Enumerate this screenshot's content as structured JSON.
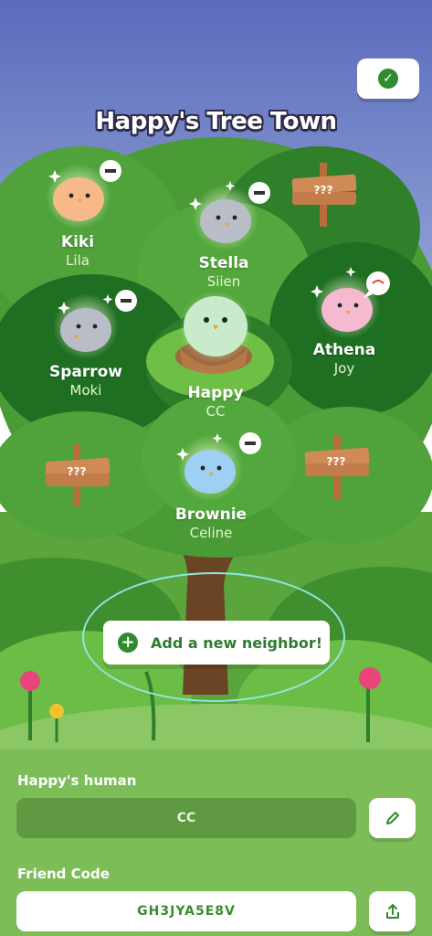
{
  "town": {
    "title": "Happy's Tree Town"
  },
  "birds": [
    {
      "name": "Kiki",
      "human": "Lila",
      "color": "#f6b98a"
    },
    {
      "name": "Stella",
      "human": "Siien",
      "color": "#b9bdc8"
    },
    {
      "name": "Sparrow",
      "human": "Moki",
      "color": "#b9bdc8"
    },
    {
      "name": "Happy",
      "human": "CC",
      "color": "#c8ebcc"
    },
    {
      "name": "Athena",
      "human": "Joy",
      "color": "#f5b9d0"
    },
    {
      "name": "Brownie",
      "human": "Celine",
      "color": "#9dd0f3"
    }
  ],
  "signs": [
    "???",
    "???",
    "???"
  ],
  "add_neighbor": {
    "label": "Add a new neighbor!"
  },
  "profile": {
    "human_label": "Happy's human",
    "human_value": "CC",
    "friend_code_label": "Friend Code",
    "friend_code_value": "GH3JYA5E8V"
  },
  "icons": {
    "confirm": "check-icon",
    "remove": "minus-icon",
    "add": "plus-icon",
    "edit": "pencil-icon",
    "share": "share-icon"
  },
  "colors": {
    "accent": "#2e8b2e",
    "sky_top": "#5c6fbd",
    "sky_bottom": "#8fa1d8",
    "canopy_dark": "#2a7a2a",
    "canopy_light": "#55a83e"
  }
}
